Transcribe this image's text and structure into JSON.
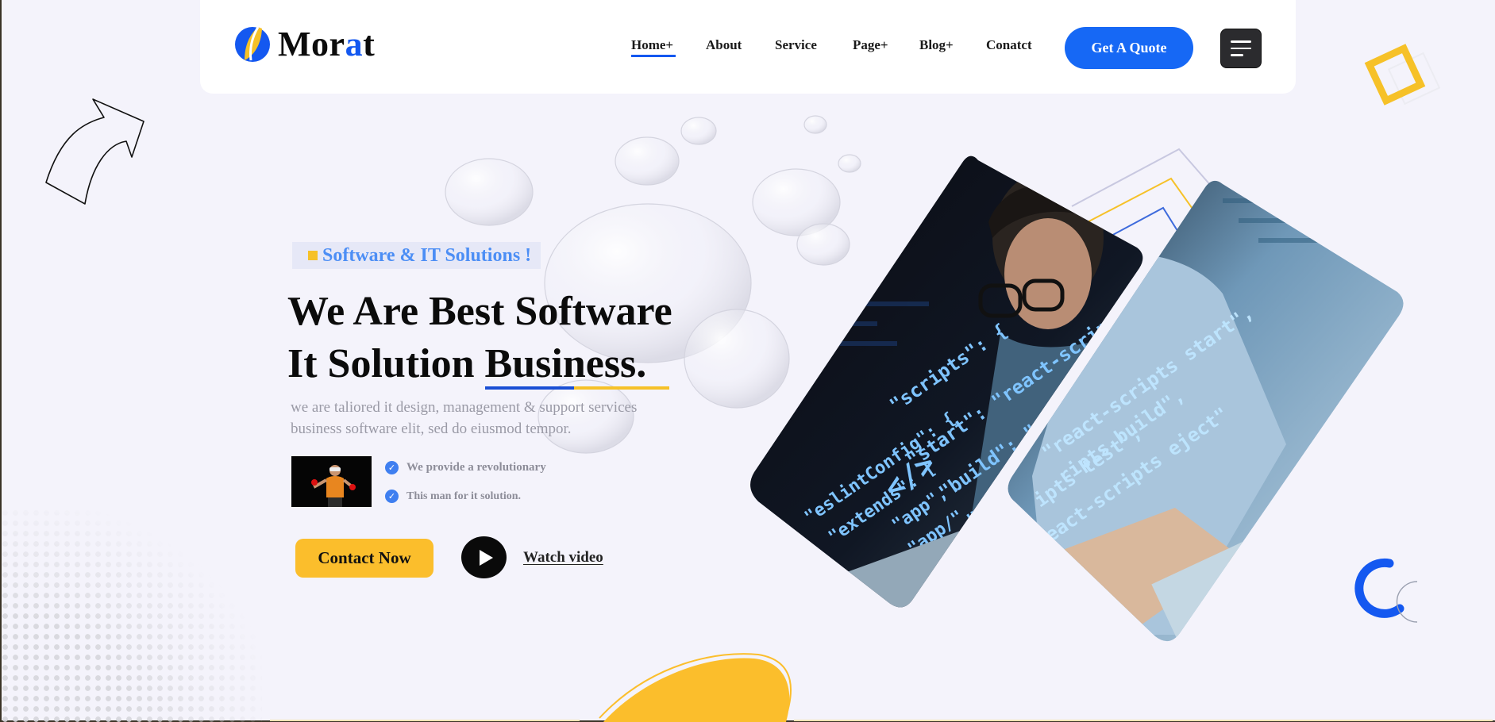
{
  "brand": {
    "name_prefix": "Mor",
    "name_accent": "a",
    "name_suffix": "t",
    "logo_icon": "leaf-logo-icon",
    "accent_color": "#1458f0",
    "secondary_color": "#f6c128"
  },
  "nav": {
    "items": [
      {
        "label": "Home+",
        "active": true
      },
      {
        "label": "About"
      },
      {
        "label": "Service"
      },
      {
        "label": "Page+"
      },
      {
        "label": "Blog+"
      },
      {
        "label": "Conatct"
      }
    ],
    "quote_label": "Get A Quote",
    "menu_icon": "hamburger-menu-icon"
  },
  "hero": {
    "tag": "Software & IT Solutions !",
    "headline_line1": "We Are Best Software",
    "headline_line2_prefix": "It Solution ",
    "headline_line2_emph": "Business.",
    "description_line1": "we are taliored it design,  management & support services",
    "description_line2": "business software elit, sed do eiusmod tempor.",
    "checks": [
      "We provide a  revolutionary",
      "This man  for it solution."
    ],
    "contact_label": "Contact Now",
    "watch_label": "Watch video"
  }
}
